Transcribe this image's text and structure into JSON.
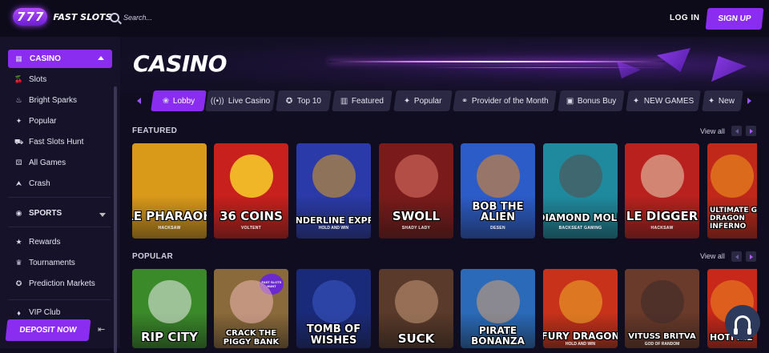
{
  "header": {
    "logo_digits": [
      "7",
      "7",
      "7"
    ],
    "logo_text": "FAST SLOTS",
    "search_placeholder": "Search...",
    "login_label": "LOG IN",
    "signup_label": "SIGN UP"
  },
  "sidebar": {
    "casino_label": "CASINO",
    "items": [
      {
        "label": "Slots",
        "icon": "cherry-icon"
      },
      {
        "label": "Bright Sparks",
        "icon": "flame-icon"
      },
      {
        "label": "Popular",
        "icon": "sparkle-icon"
      },
      {
        "label": "Fast Slots Hunt",
        "icon": "hunt-icon"
      },
      {
        "label": "All Games",
        "icon": "dice-icon"
      },
      {
        "label": "Crash",
        "icon": "rocket-icon"
      }
    ],
    "sports_label": "SPORTS",
    "extras": [
      {
        "label": "Rewards",
        "icon": "star-icon"
      },
      {
        "label": "Tournaments",
        "icon": "trophy-icon"
      },
      {
        "label": "Prediction Markets",
        "icon": "medal-icon"
      },
      {
        "label": "VIP Club",
        "icon": "vip-icon"
      }
    ],
    "deposit_label": "DEPOSIT NOW"
  },
  "main": {
    "title": "CASINO",
    "tabs": [
      {
        "label": "Lobby",
        "active": true
      },
      {
        "label": "Live Casino"
      },
      {
        "label": "Top 10"
      },
      {
        "label": "Featured"
      },
      {
        "label": "Popular"
      },
      {
        "label": "Provider of the Month"
      },
      {
        "label": "Bonus Buy"
      },
      {
        "label": "NEW GAMES"
      },
      {
        "label": "New"
      }
    ],
    "view_all_label": "View all",
    "featured": {
      "title": "FEATURED",
      "games": [
        {
          "title": "LE PHARAOH",
          "provider": "HACKSAW",
          "color": "#d99a1a"
        },
        {
          "title": "36 COINS",
          "provider": "VOLTENT",
          "color": "#c8201c"
        },
        {
          "title": "THUNDERLINE EXPRESS",
          "sub": "HOLD AND WIN",
          "provider": "",
          "color": "#2a3aa8"
        },
        {
          "title": "SWOLL",
          "provider": "SHADY LADY",
          "color": "#7a1a1a"
        },
        {
          "title": "BOB THE ALIEN",
          "provider": "DESEN",
          "color": "#2c5cc8"
        },
        {
          "title": "DIAMOND MOLE",
          "provider": "BACKSEAT GAMING",
          "color": "#1f8a9e"
        },
        {
          "title": "LE DIGGER",
          "provider": "HACKSAW",
          "color": "#b8211e"
        },
        {
          "title": "ULTIMATE GOLD DRAGON INFERNO",
          "provider": "",
          "color": "#c0281a"
        }
      ]
    },
    "popular": {
      "title": "POPULAR",
      "games": [
        {
          "title": "RIP CITY",
          "color": "#3a8a2a"
        },
        {
          "title": "CRACK THE PIGGY BANK",
          "badge": "FAST SLOTS HUNT",
          "color": "#8a6a3a"
        },
        {
          "title": "TOMB OF WISHES",
          "color": "#1a2a7a"
        },
        {
          "title": "SUCK",
          "color": "#5a3a2a"
        },
        {
          "title": "PIRATE BONANZA",
          "color": "#2a6ab8"
        },
        {
          "title": "FURY DRAGON",
          "sub": "HOLD AND WIN",
          "color": "#c8321a"
        },
        {
          "title": "VITUSS BRITVA",
          "sub": "GOD OF RANDOM",
          "color": "#6a3a2a"
        },
        {
          "title": "HOTFIRE",
          "color": "#c8281a"
        }
      ]
    }
  }
}
